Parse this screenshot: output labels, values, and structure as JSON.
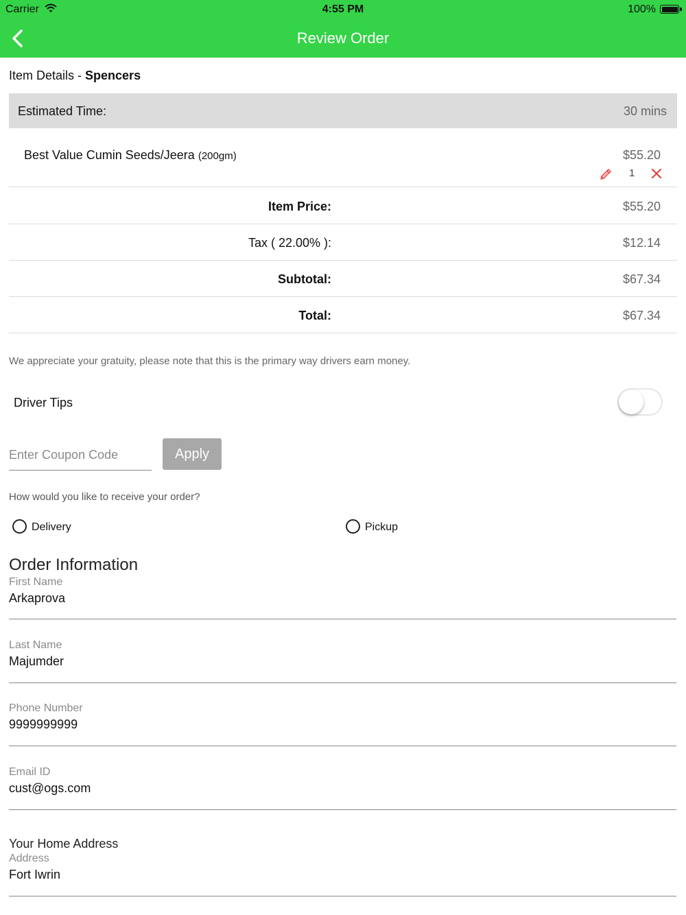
{
  "status_bar": {
    "carrier": "Carrier",
    "time": "4:55 PM",
    "battery": "100%",
    "wifi_icon": "wifi-icon",
    "battery_icon": "battery-icon"
  },
  "nav": {
    "title": "Review Order",
    "back_icon": "chevron-left-icon",
    "bar_color": "#34d348"
  },
  "item_details": {
    "prefix": "Item Details - ",
    "store": "Spencers"
  },
  "estimated_time": {
    "label": "Estimated Time:",
    "value": "30 mins"
  },
  "cart_items": [
    {
      "name": "Best Value Cumin Seeds/Jeera",
      "size": "(200gm)",
      "price": "$55.20",
      "quantity": "1",
      "edit_icon": "pencil-icon",
      "remove_icon": "close-icon"
    }
  ],
  "summary": {
    "item_price_label": "Item Price:",
    "item_price": "$55.20",
    "tax_label": "Tax ( 22.00% ):",
    "tax": "$12.14",
    "subtotal_label": "Subtotal:",
    "subtotal": "$67.34",
    "total_label": "Total:",
    "total": "$67.34"
  },
  "gratuity_note": "We appreciate your gratuity, please note that this is the primary way drivers earn money.",
  "driver_tips": {
    "label": "Driver Tips",
    "enabled": false
  },
  "coupon": {
    "placeholder": "Enter Coupon Code",
    "value": "",
    "apply_label": "Apply"
  },
  "receive": {
    "question": "How would you like to receive your order?",
    "options": [
      "Delivery",
      "Pickup"
    ],
    "selected": null
  },
  "order_info": {
    "heading": "Order Information",
    "fields": [
      {
        "label": "First Name",
        "value": "Arkaprova"
      },
      {
        "label": "Last Name",
        "value": "Majumder"
      },
      {
        "label": "Phone Number",
        "value": "9999999999"
      },
      {
        "label": "Email ID",
        "value": "cust@ogs.com"
      }
    ],
    "address_heading": "Your Home Address",
    "address": {
      "label": "Address",
      "value": "Fort Iwrin"
    }
  },
  "colors": {
    "accent": "#34d348",
    "remove": "#e53935",
    "edit": "#e53935"
  }
}
